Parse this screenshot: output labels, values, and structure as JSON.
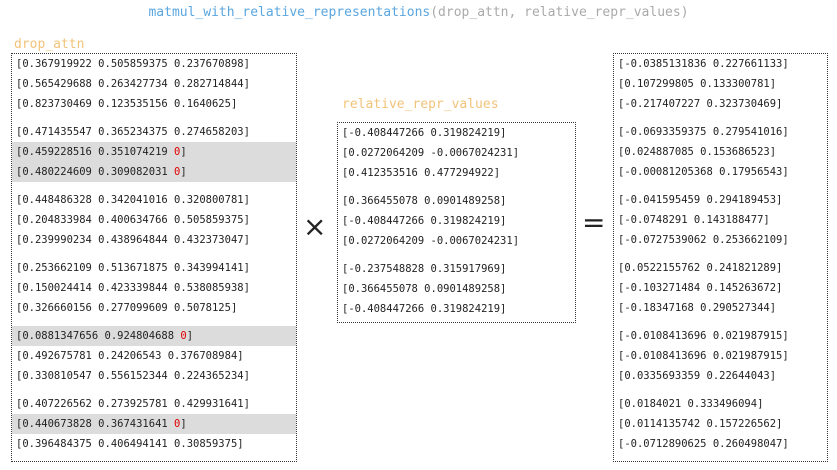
{
  "title": {
    "function": "matmul_with_relative_representations",
    "args": "(drop_attn, relative_repr_values)"
  },
  "left": {
    "label": "drop_attn",
    "blocks": [
      [
        {
          "open": "[",
          "values": "0.367919922 0.505859375 0.237670898",
          "close": "]",
          "zero": "",
          "highlight": false
        },
        {
          "open": "[",
          "values": "0.565429688 0.263427734 0.282714844",
          "close": "]",
          "zero": "",
          "highlight": false
        },
        {
          "open": "[",
          "values": "0.823730469 0.123535156 0.1640625",
          "close": "]",
          "zero": "",
          "highlight": false
        }
      ],
      [
        {
          "open": "[",
          "values": "0.471435547 0.365234375 0.274658203",
          "close": "]",
          "zero": "",
          "highlight": false
        },
        {
          "open": "[",
          "values": "0.459228516 0.351074219 ",
          "close": "]",
          "zero": "0",
          "highlight": true
        },
        {
          "open": "[",
          "values": "0.480224609 0.309082031 ",
          "close": "]",
          "zero": "0",
          "highlight": true
        }
      ],
      [
        {
          "open": "[",
          "values": "0.448486328 0.342041016 0.320800781",
          "close": "]",
          "zero": "",
          "highlight": false
        },
        {
          "open": "[",
          "values": "0.204833984 0.400634766 0.505859375",
          "close": "]",
          "zero": "",
          "highlight": false
        },
        {
          "open": "[",
          "values": "0.239990234 0.438964844 0.432373047",
          "close": "]",
          "zero": "",
          "highlight": false
        }
      ],
      [
        {
          "open": "[",
          "values": "0.253662109 0.513671875 0.343994141",
          "close": "]",
          "zero": "",
          "highlight": false
        },
        {
          "open": "[",
          "values": "0.150024414 0.423339844 0.538085938",
          "close": "]",
          "zero": "",
          "highlight": false
        },
        {
          "open": "[",
          "values": "0.326660156 0.277099609 0.5078125",
          "close": "]",
          "zero": "",
          "highlight": false
        }
      ],
      [
        {
          "open": "[",
          "values": "0.0881347656 0.924804688 ",
          "close": "]",
          "zero": "0",
          "highlight": true
        },
        {
          "open": "[",
          "values": "0.492675781 0.24206543 0.376708984",
          "close": "]",
          "zero": "",
          "highlight": false
        },
        {
          "open": "[",
          "values": "0.330810547 0.556152344 0.224365234",
          "close": "]",
          "zero": "",
          "highlight": false
        }
      ],
      [
        {
          "open": "[",
          "values": "0.407226562 0.273925781 0.429931641",
          "close": "]",
          "zero": "",
          "highlight": false
        },
        {
          "open": "[",
          "values": "0.440673828 0.367431641 ",
          "close": "]",
          "zero": "0",
          "highlight": true
        },
        {
          "open": "[",
          "values": "0.396484375 0.406494141 0.30859375",
          "close": "]",
          "zero": "",
          "highlight": false
        }
      ]
    ]
  },
  "operator_times": "×",
  "operator_equals": "=",
  "middle": {
    "label": "relative_repr_values",
    "blocks": [
      [
        {
          "open": "[",
          "values": "-0.408447266 0.319824219",
          "close": "]",
          "zero": "",
          "highlight": false
        },
        {
          "open": "[",
          "values": "0.0272064209 -0.0067024231",
          "close": "]",
          "zero": "",
          "highlight": false
        },
        {
          "open": "[",
          "values": "0.412353516 0.477294922",
          "close": "]",
          "zero": "",
          "highlight": false
        }
      ],
      [
        {
          "open": "[",
          "values": "0.366455078 0.0901489258",
          "close": "]",
          "zero": "",
          "highlight": false
        },
        {
          "open": "[",
          "values": "-0.408447266 0.319824219",
          "close": "]",
          "zero": "",
          "highlight": false
        },
        {
          "open": "[",
          "values": "0.0272064209 -0.0067024231",
          "close": "]",
          "zero": "",
          "highlight": false
        }
      ],
      [
        {
          "open": "[",
          "values": "-0.237548828 0.315917969",
          "close": "]",
          "zero": "",
          "highlight": false
        },
        {
          "open": "[",
          "values": "0.366455078 0.0901489258",
          "close": "]",
          "zero": "",
          "highlight": false
        },
        {
          "open": "[",
          "values": "-0.408447266 0.319824219",
          "close": "]",
          "zero": "",
          "highlight": false
        }
      ]
    ]
  },
  "right": {
    "blocks": [
      [
        {
          "open": "[",
          "values": "-0.0385131836 0.227661133",
          "close": "]",
          "zero": "",
          "highlight": false
        },
        {
          "open": "[",
          "values": "0.107299805 0.133300781",
          "close": "]",
          "zero": "",
          "highlight": false
        },
        {
          "open": "[",
          "values": "-0.217407227 0.323730469",
          "close": "]",
          "zero": "",
          "highlight": false
        }
      ],
      [
        {
          "open": "[",
          "values": "-0.0693359375 0.279541016",
          "close": "]",
          "zero": "",
          "highlight": false
        },
        {
          "open": "[",
          "values": "0.024887085 0.153686523",
          "close": "]",
          "zero": "",
          "highlight": false
        },
        {
          "open": "[",
          "values": "-0.00081205368 0.17956543",
          "close": "]",
          "zero": "",
          "highlight": false
        }
      ],
      [
        {
          "open": "[",
          "values": "-0.041595459 0.294189453",
          "close": "]",
          "zero": "",
          "highlight": false
        },
        {
          "open": "[",
          "values": "-0.0748291 0.143188477",
          "close": "]",
          "zero": "",
          "highlight": false
        },
        {
          "open": "[",
          "values": "-0.0727539062 0.253662109",
          "close": "]",
          "zero": "",
          "highlight": false
        }
      ],
      [
        {
          "open": "[",
          "values": "0.0522155762 0.241821289",
          "close": "]",
          "zero": "",
          "highlight": false
        },
        {
          "open": "[",
          "values": "-0.103271484 0.145263672",
          "close": "]",
          "zero": "",
          "highlight": false
        },
        {
          "open": "[",
          "values": "-0.18347168 0.290527344",
          "close": "]",
          "zero": "",
          "highlight": false
        }
      ],
      [
        {
          "open": "[",
          "values": "-0.0108413696 0.021987915",
          "close": "]",
          "zero": "",
          "highlight": false
        },
        {
          "open": "[",
          "values": "-0.0108413696 0.021987915",
          "close": "]",
          "zero": "",
          "highlight": false
        },
        {
          "open": "[",
          "values": "0.0335693359 0.22644043",
          "close": "]",
          "zero": "",
          "highlight": false
        }
      ],
      [
        {
          "open": "[",
          "values": "0.0184021 0.333496094",
          "close": "]",
          "zero": "",
          "highlight": false
        },
        {
          "open": "[",
          "values": "0.0114135742 0.157226562",
          "close": "]",
          "zero": "",
          "highlight": false
        },
        {
          "open": "[",
          "values": "-0.0712890625 0.260498047",
          "close": "]",
          "zero": "",
          "highlight": false
        }
      ]
    ]
  },
  "colors": {
    "function_name": "#5aa6e0",
    "arguments": "#aaaaaa",
    "matrix_label": "#f2c37a",
    "masked_zero": "#e00000",
    "row_highlight": "#dcdcdc"
  }
}
